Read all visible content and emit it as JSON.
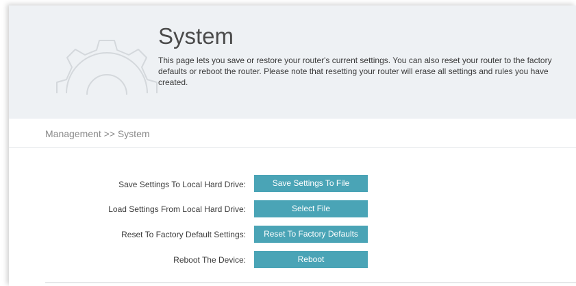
{
  "header": {
    "title": "System",
    "description": "This page lets you save or restore your router's current settings. You can also reset your router to the factory defaults or reboot the router. Please note that resetting your router will erase all settings and rules you have created.",
    "icon": "gear-icon"
  },
  "breadcrumb": "Management >> System",
  "rows": [
    {
      "label": "Save Settings To Local Hard Drive:",
      "button": "Save Settings To File"
    },
    {
      "label": "Load Settings From Local Hard Drive:",
      "button": "Select File"
    },
    {
      "label": "Reset To Factory Default Settings:",
      "button": "Reset To Factory Defaults"
    },
    {
      "label": "Reboot The Device:",
      "button": "Reboot"
    }
  ],
  "colors": {
    "header_bg": "#eef1f4",
    "button_bg": "#4aa4b6",
    "button_text": "#ffffff"
  }
}
